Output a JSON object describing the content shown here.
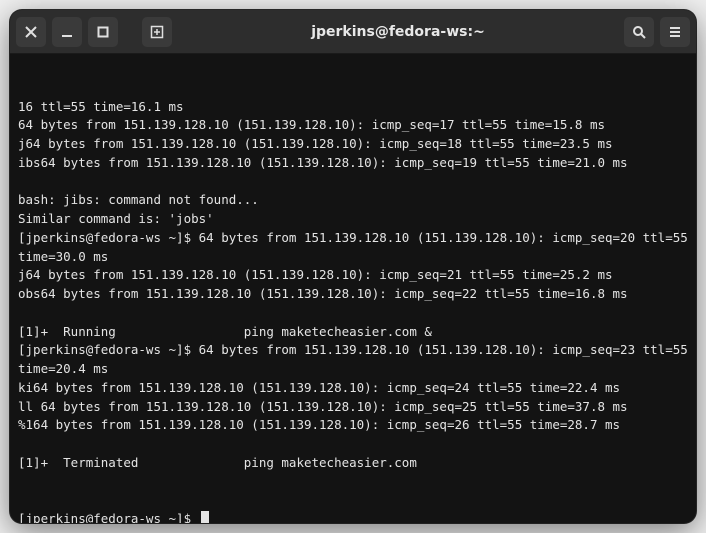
{
  "window": {
    "title": "jperkins@fedora-ws:~"
  },
  "lines": [
    "16 ttl=55 time=16.1 ms",
    "64 bytes from 151.139.128.10 (151.139.128.10): icmp_seq=17 ttl=55 time=15.8 ms",
    "j64 bytes from 151.139.128.10 (151.139.128.10): icmp_seq=18 ttl=55 time=23.5 ms",
    "ibs64 bytes from 151.139.128.10 (151.139.128.10): icmp_seq=19 ttl=55 time=21.0 ms",
    "",
    "bash: jibs: command not found...",
    "Similar command is: 'jobs'",
    "[jperkins@fedora-ws ~]$ 64 bytes from 151.139.128.10 (151.139.128.10): icmp_seq=20 ttl=55 time=30.0 ms",
    "j64 bytes from 151.139.128.10 (151.139.128.10): icmp_seq=21 ttl=55 time=25.2 ms",
    "obs64 bytes from 151.139.128.10 (151.139.128.10): icmp_seq=22 ttl=55 time=16.8 ms",
    "",
    "[1]+  Running                 ping maketecheasier.com &",
    "[jperkins@fedora-ws ~]$ 64 bytes from 151.139.128.10 (151.139.128.10): icmp_seq=23 ttl=55 time=20.4 ms",
    "ki64 bytes from 151.139.128.10 (151.139.128.10): icmp_seq=24 ttl=55 time=22.4 ms",
    "ll 64 bytes from 151.139.128.10 (151.139.128.10): icmp_seq=25 ttl=55 time=37.8 ms",
    "%164 bytes from 151.139.128.10 (151.139.128.10): icmp_seq=26 ttl=55 time=28.7 ms",
    "",
    "[1]+  Terminated              ping maketecheasier.com"
  ],
  "prompt": "[jperkins@fedora-ws ~]$ "
}
